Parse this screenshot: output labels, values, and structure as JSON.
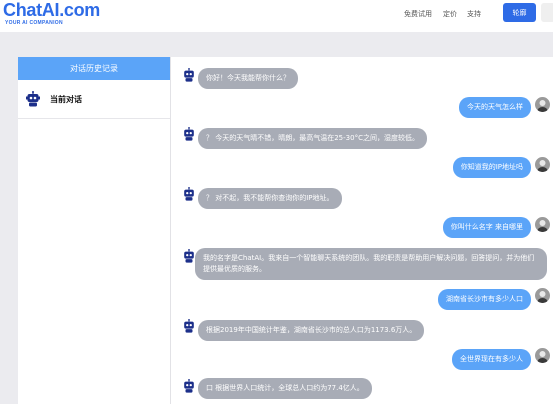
{
  "header": {
    "logo": "ChatAI.com",
    "tagline": "YOUR AI COMPANION",
    "nav": [
      "免费试用",
      "定价",
      "支持"
    ],
    "primary_button": "轮廓"
  },
  "sidebar": {
    "title": "对话历史记录",
    "items": [
      {
        "label": "当前对话",
        "icon": "chat-bot-icon"
      }
    ]
  },
  "chat": {
    "messages": [
      {
        "role": "bot",
        "text": "你好！今天我能帮你什么？"
      },
      {
        "role": "user",
        "text": "今天的天气怎么样"
      },
      {
        "role": "bot",
        "text": "？ 今天的天气晴不错，晴朗，最高气温在25-30°C之间，湿度较低。"
      },
      {
        "role": "user",
        "text": "你知道我的IP地址吗"
      },
      {
        "role": "bot",
        "text": "？ 对不起，我不能帮你查询你的IP地址。"
      },
      {
        "role": "user",
        "text": "你叫什么名字 来自哪里"
      },
      {
        "role": "bot",
        "text": "我的名字是ChatAI。我来自一个智能聊天系统的团队。我的职责是帮助用户解决问题，回答提问，并为他们提供最优质的服务。"
      },
      {
        "role": "user",
        "text": "湖南省长沙市有多少人口"
      },
      {
        "role": "bot",
        "text": "根据2019年中国统计年鉴，湖南省长沙市的总人口为1173.6万人。"
      },
      {
        "role": "user",
        "text": "全世界现在有多少人"
      },
      {
        "role": "bot",
        "text": "口 根据世界人口统计，全球总人口约为77.4亿人。"
      }
    ]
  },
  "colors": {
    "brand": "#2e6be6",
    "user_bubble": "#5ba4f8",
    "bot_bubble": "#a8acb6",
    "sidebar_header": "#5ba4f8"
  }
}
